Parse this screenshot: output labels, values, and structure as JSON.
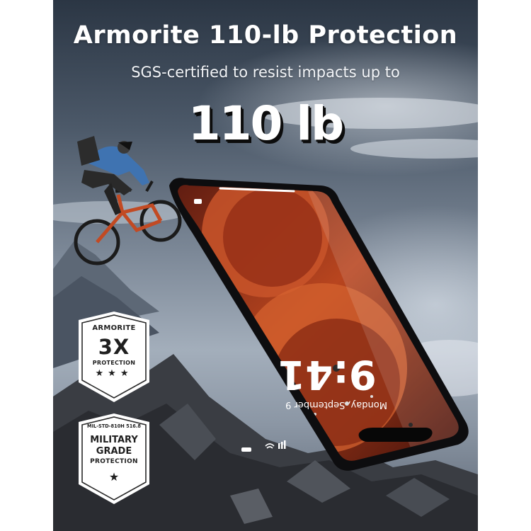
{
  "headline": "Armorite 110-lb Protection",
  "subline": "SGS-certified to resist impacts up to",
  "big_weight": "110 lb",
  "badges": {
    "armorite": {
      "top": "ARMORITE",
      "big": "3X",
      "sub": "PROTECTION",
      "stars": "★★★"
    },
    "military": {
      "top": "MIL-STD-810H 516.8",
      "line1": "MILITARY",
      "line2": "GRADE",
      "line3": "PROTECTION",
      "star": "★"
    }
  },
  "lock_screen": {
    "time": "9:41",
    "date": "Monday, September 9"
  },
  "icons": [
    "cyclist-illustration",
    "phone-illustration",
    "rock-mountain-illustration",
    "camera-icon",
    "flashlight-icon",
    "signal-icon",
    "wifi-icon",
    "star-icon"
  ],
  "colors": {
    "sky_dark": "#2b3644",
    "sky_light": "#a3aebb",
    "badge_fill": "#ffffff",
    "text_dark": "#1f1f1f",
    "wallpaper_orange": "#c4502b"
  }
}
